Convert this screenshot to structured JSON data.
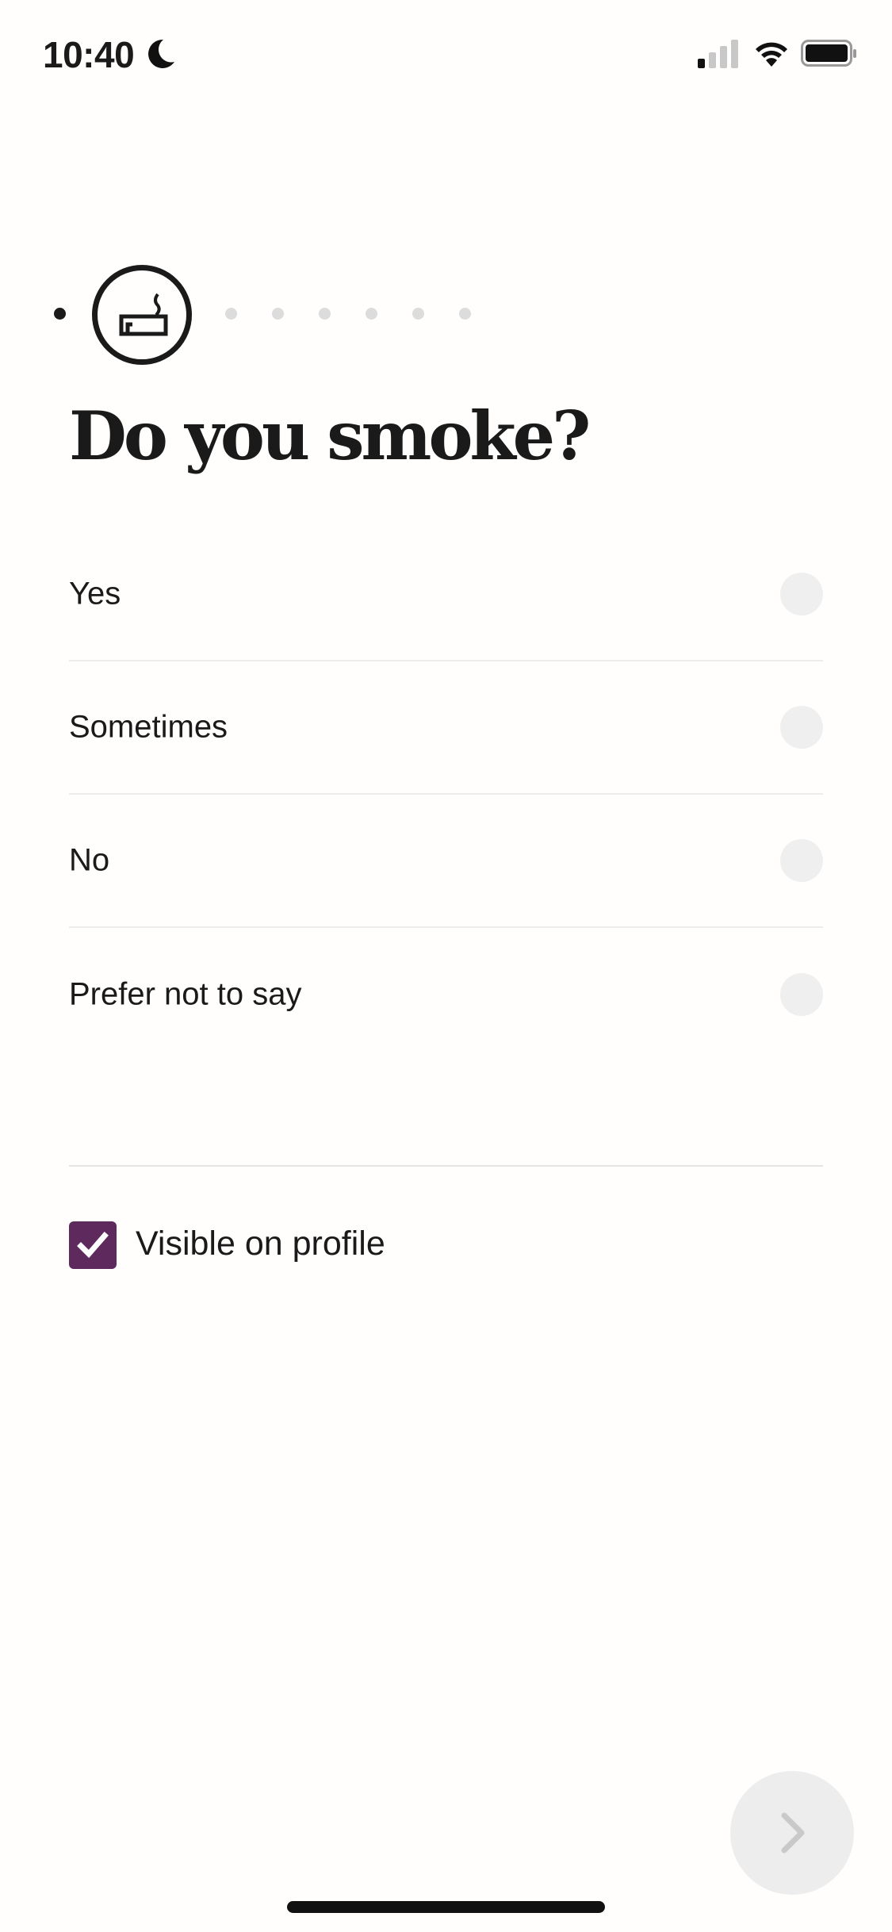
{
  "status_bar": {
    "time": "10:40",
    "focus_icon": "moon-icon",
    "signal_bars_active": 1,
    "signal_bars_total": 4,
    "battery_level": 1.0
  },
  "progress": {
    "current_step": 2,
    "total_steps": 8,
    "current_icon": "cigarette-icon"
  },
  "question": {
    "title": "Do you smoke?"
  },
  "options": [
    {
      "label": "Yes",
      "selected": false
    },
    {
      "label": "Sometimes",
      "selected": false
    },
    {
      "label": "No",
      "selected": false
    },
    {
      "label": "Prefer not to say",
      "selected": false
    }
  ],
  "visibility": {
    "label": "Visible on profile",
    "checked": true,
    "color": "#5e2a5d"
  },
  "next_button": {
    "icon": "chevron-right-icon",
    "enabled": false
  }
}
